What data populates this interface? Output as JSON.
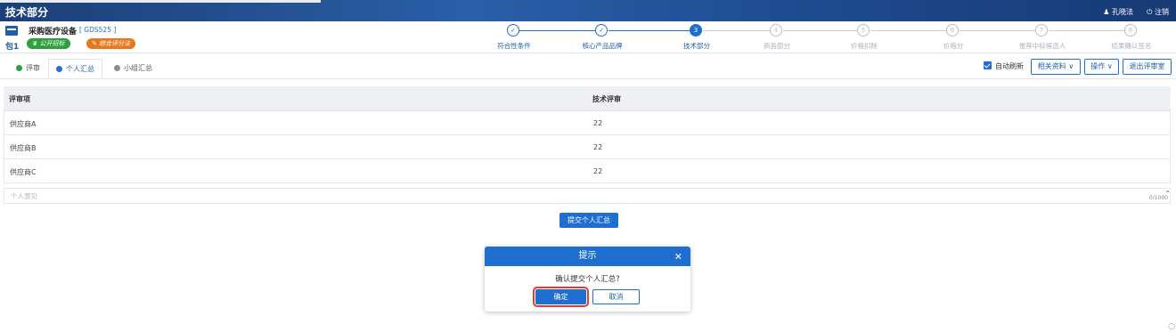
{
  "header": {
    "title": "技术部分",
    "user": "孔晓法",
    "logout": "注销"
  },
  "project": {
    "name": "采购医疗设备",
    "code": "[ GDS525 ]",
    "package": "包1",
    "tag_method": "公开招标",
    "tag_eval": "综合评分法"
  },
  "steps": [
    {
      "num": "✓",
      "label": "符合性条件",
      "state": "done"
    },
    {
      "num": "✓",
      "label": "核心产品品牌",
      "state": "done"
    },
    {
      "num": "3",
      "label": "技术部分",
      "state": "current"
    },
    {
      "num": "4",
      "label": "商务部分",
      "state": "todo"
    },
    {
      "num": "5",
      "label": "价格扣除",
      "state": "todo"
    },
    {
      "num": "6",
      "label": "价格分",
      "state": "todo"
    },
    {
      "num": "7",
      "label": "推荐中标候选人",
      "state": "todo"
    },
    {
      "num": "8",
      "label": "结果确认签名",
      "state": "todo"
    }
  ],
  "tabs": [
    {
      "label": "评审",
      "color": "#2f9e3d"
    },
    {
      "label": "个人汇总",
      "color": "#1f6fd0"
    },
    {
      "label": "小组汇总",
      "color": "#8a8f96"
    }
  ],
  "toolbar": {
    "auto_refresh": "自动刷新",
    "related": "相关资料",
    "operate": "操作",
    "exit": "退出评审室"
  },
  "table": {
    "headers": [
      "评审项",
      "技术评审"
    ],
    "rows": [
      [
        "供应商A",
        "22"
      ],
      [
        "供应商B",
        "22"
      ],
      [
        "供应商C",
        "22"
      ]
    ]
  },
  "opinion": {
    "placeholder": "个人意见",
    "counter": "0/1000"
  },
  "submit_label": "提交个人汇总",
  "dialog": {
    "title": "提示",
    "message": "确认提交个人汇总?",
    "ok": "确定",
    "cancel": "取消"
  },
  "colors": {
    "primary": "#1f6fd0",
    "header_bg": "#1d4a8f",
    "highlight": "#e53935"
  }
}
